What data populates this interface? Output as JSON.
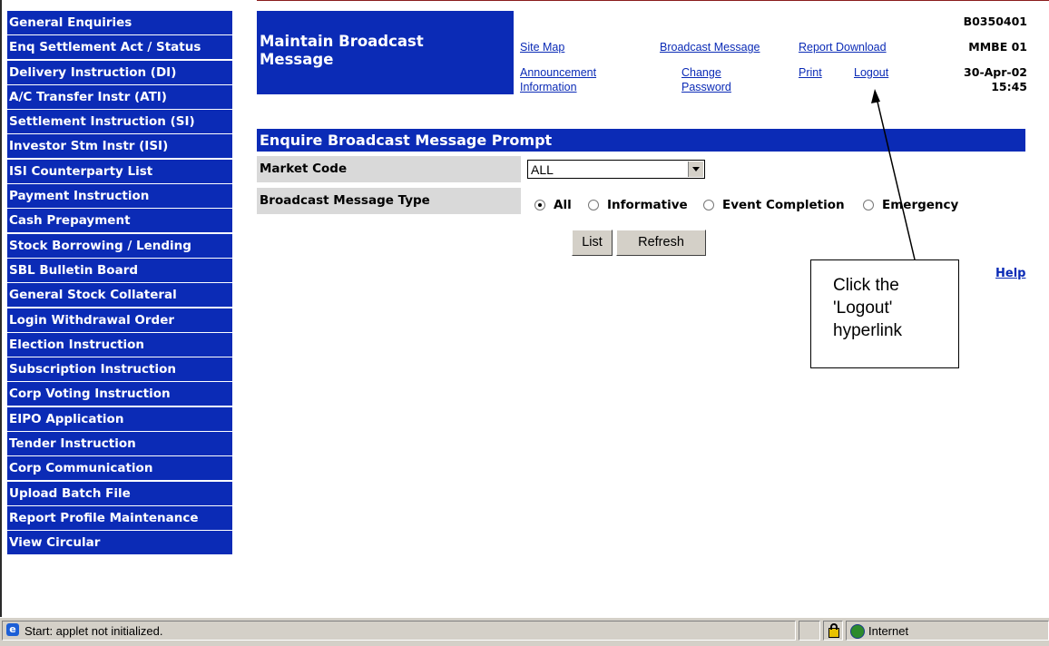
{
  "sidebar": {
    "items": [
      {
        "label": "General Enquiries"
      },
      {
        "label": "Enq Settlement Act / Status"
      },
      {
        "label": "Delivery Instruction (DI)"
      },
      {
        "label": "A/C Transfer Instr (ATI)"
      },
      {
        "label": "Settlement Instruction (SI)"
      },
      {
        "label": "Investor Stm Instr (ISI)"
      },
      {
        "label": "ISI Counterparty List"
      },
      {
        "label": "Payment Instruction"
      },
      {
        "label": "Cash Prepayment"
      },
      {
        "label": "Stock Borrowing / Lending"
      },
      {
        "label": "SBL Bulletin Board"
      },
      {
        "label": "General Stock Collateral"
      },
      {
        "label": "Login Withdrawal Order"
      },
      {
        "label": "Election Instruction"
      },
      {
        "label": "Subscription Instruction"
      },
      {
        "label": "Corp Voting Instruction"
      },
      {
        "label": "EIPO Application"
      },
      {
        "label": "Tender Instruction"
      },
      {
        "label": "Corp Communication"
      },
      {
        "label": "Upload Batch File"
      },
      {
        "label": "Report Profile Maintenance"
      },
      {
        "label": "View Circular"
      }
    ]
  },
  "header": {
    "title": "Maintain Broadcast Message",
    "links": {
      "site_map": "Site Map",
      "broadcast_message": "Broadcast Message",
      "report_download": "Report Download",
      "announcement_information": "Announcement Information",
      "change_password": "Change Password",
      "print": "Print",
      "logout": "Logout"
    },
    "info": {
      "code": "B0350401",
      "screen_id": "MMBE 01",
      "date": "30-Apr-02",
      "time": "15:45"
    }
  },
  "form": {
    "section_title": "Enquire Broadcast Message Prompt",
    "market_code_label": "Market Code",
    "market_code_value": "ALL",
    "message_type_label": "Broadcast Message Type",
    "message_types": [
      {
        "label": "All",
        "checked": true
      },
      {
        "label": "Informative",
        "checked": false
      },
      {
        "label": "Event Completion",
        "checked": false
      },
      {
        "label": "Emergency",
        "checked": false
      }
    ],
    "list_button": "List",
    "refresh_button": "Refresh",
    "help_link": "Help"
  },
  "annotation": {
    "text": "Click the 'Logout' hyperlink"
  },
  "statusbar": {
    "message": "Start: applet not initialized.",
    "zone": "Internet"
  },
  "colors": {
    "nav_blue": "#0b2bb6",
    "label_gray": "#d9d9d9",
    "chrome_gray": "#d4d0c8"
  }
}
